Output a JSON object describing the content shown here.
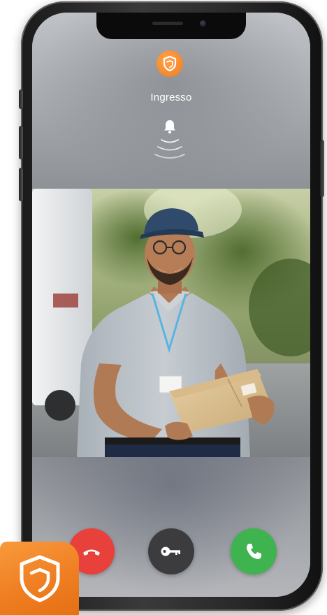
{
  "intercom": {
    "door_name": "Ingresso",
    "brand_color": "#ef7d1f"
  },
  "icons": {
    "brand": "shield-icon",
    "ringing": "bell-icon",
    "decline": "phone-hangup-icon",
    "unlock": "key-icon",
    "accept": "phone-icon"
  },
  "call_actions": [
    {
      "name": "decline",
      "color": "#e8403b"
    },
    {
      "name": "unlock",
      "color": "#3c3c3e"
    },
    {
      "name": "accept",
      "color": "#3fb34f"
    }
  ]
}
